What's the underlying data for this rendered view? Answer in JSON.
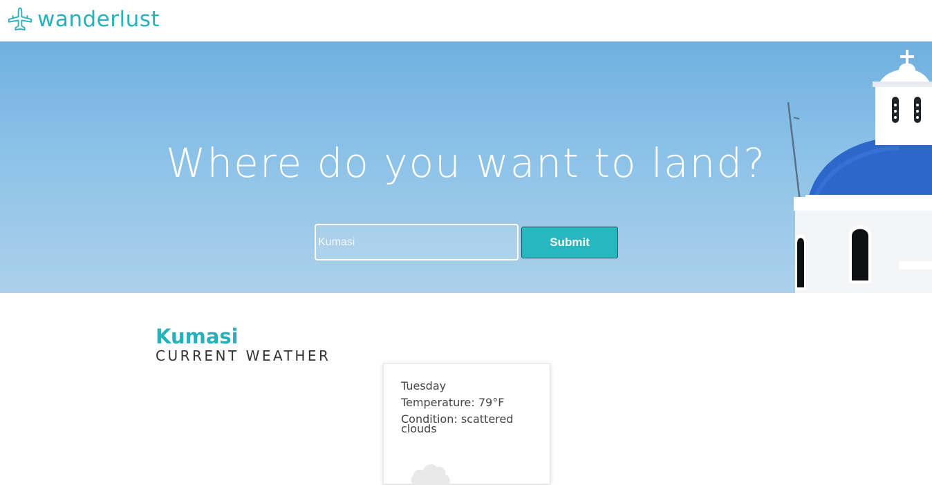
{
  "header": {
    "logo_text": "wanderlust",
    "logo_icon": "airplane-icon",
    "brand_color": "#27b1bc"
  },
  "hero": {
    "title": "Where do you want to land?",
    "search": {
      "value": "",
      "placeholder": "Kumasi"
    },
    "submit_label": "Submit"
  },
  "results": {
    "city": "Kumasi",
    "subtitle": "CURRENT WEATHER",
    "card": {
      "day": "Tuesday",
      "temperature": "Temperature: 79°F",
      "condition": "Condition: scattered clouds",
      "icon": "cloud-icon"
    }
  }
}
